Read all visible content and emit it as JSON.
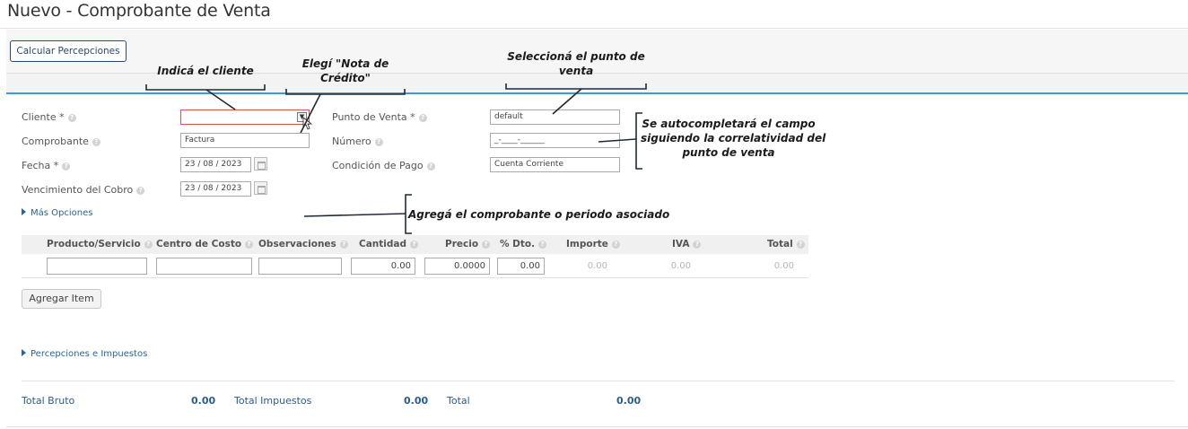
{
  "page": {
    "title": "Nuevo - Comprobante de Venta"
  },
  "toolbar": {
    "calc_label": "Calcular Percepciones"
  },
  "form": {
    "cliente": {
      "label": "Cliente *",
      "value": ""
    },
    "comprobante": {
      "label": "Comprobante",
      "value": "Factura"
    },
    "fecha": {
      "label": "Fecha *",
      "value": "23 / 08 / 2023"
    },
    "vencimiento": {
      "label": "Vencimiento del Cobro",
      "value": "23 / 08 / 2023"
    },
    "punto_venta": {
      "label": "Punto de Venta *",
      "value": "default"
    },
    "numero": {
      "label": "Número",
      "value": "_-____-______"
    },
    "condicion": {
      "label": "Condición de Pago",
      "value": "Cuenta Corriente"
    },
    "mas_opciones": "Más Opciones",
    "dropdown_arrow": "▼",
    "help_glyph": "?"
  },
  "items_table": {
    "headers": [
      "Producto/Servicio",
      "Centro de Costo",
      "Observaciones",
      "Cantidad",
      "Precio",
      "% Dto.",
      "Importe",
      "IVA",
      "Total"
    ],
    "row": {
      "producto": "",
      "centro": "",
      "observaciones": "",
      "cantidad": "0.00",
      "precio": "0.0000",
      "dto": "0.00",
      "importe": "0.00",
      "iva": "0.00",
      "total": "0.00"
    },
    "add_label": "Agregar Item"
  },
  "percepciones_link": "Percepciones e Impuestos",
  "totals": {
    "bruto_label": "Total Bruto",
    "bruto_value": "0.00",
    "impuestos_label": "Total Impuestos",
    "impuestos_value": "0.00",
    "total_label": "Total",
    "total_value": "0.00"
  },
  "annotations": {
    "cliente": "Indicá el cliente",
    "nota_l1": "Elegí \"Nota de",
    "nota_l2": "Crédito\"",
    "punto_l1": "Seleccioná el punto de",
    "punto_l2": "venta",
    "auto_l1": "Se autocompletará el campo",
    "auto_l2": "siguiendo la correlatividad del",
    "auto_l3": "punto de venta",
    "asociado": "Agregá el comprobante o periodo asociado"
  },
  "colors": {
    "accent": "#3a9bd9",
    "link": "#2a6496",
    "error_border": "#d9534f"
  }
}
